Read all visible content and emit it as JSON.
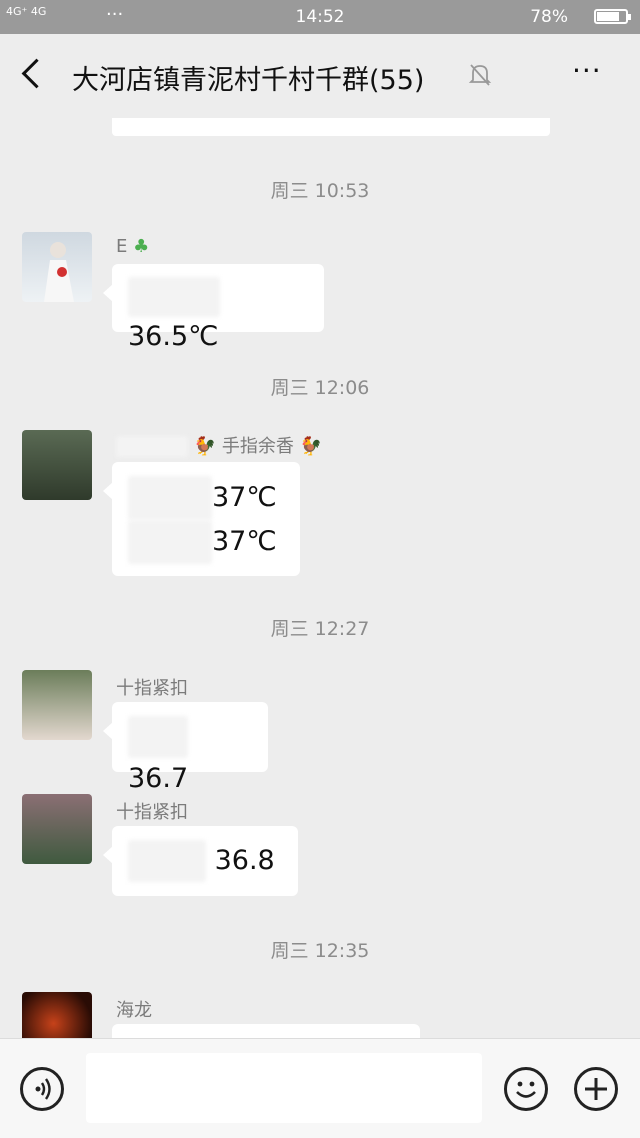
{
  "status": {
    "signal": "4G⁺ 4G",
    "time": "14:52",
    "battery": "78%",
    "battery_level": 0.78
  },
  "nav": {
    "title": "大河店镇青泥村千村千群(55)"
  },
  "timestamps": [
    "周三 10:53",
    "周三 12:06",
    "周三 12:27",
    "周三 12:35"
  ],
  "messages": [
    {
      "sender": "E",
      "lines": [
        "36.5℃"
      ]
    },
    {
      "sender": "手指余香",
      "lines": [
        "37℃",
        "37℃"
      ]
    },
    {
      "sender": "十指紧扣",
      "lines": [
        "36.7"
      ]
    },
    {
      "sender": "十指紧扣",
      "lines": [
        "36.8"
      ]
    },
    {
      "sender": "海龙",
      "lines": []
    }
  ]
}
